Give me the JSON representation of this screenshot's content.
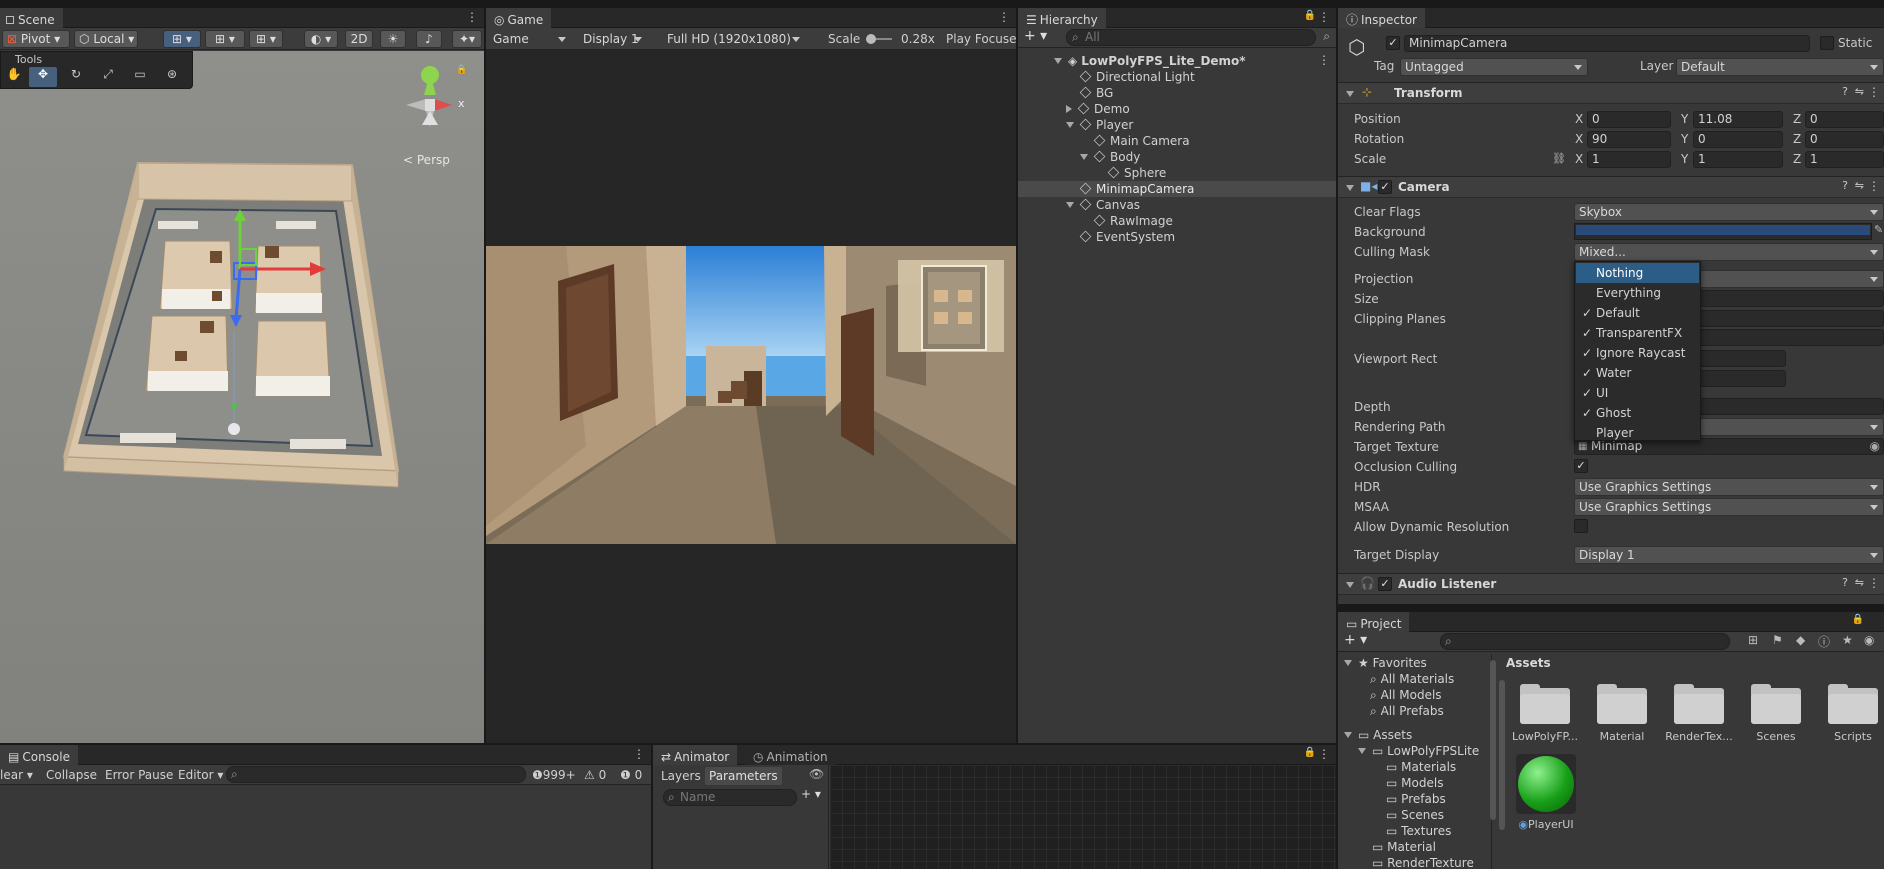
{
  "scene": {
    "tab": "Scene",
    "pivot": "Pivot",
    "local": "Local",
    "mode2d": "2D",
    "tools_label": "Tools",
    "persp": "Persp",
    "gizmo_x": "x"
  },
  "game": {
    "tab": "Game",
    "view": "Game",
    "display": "Display 1",
    "resolution": "Full HD (1920x1080)",
    "scale_label": "Scale",
    "scale_value": "0.28x",
    "play_focused": "Play Focuse"
  },
  "hierarchy": {
    "tab": "Hierarchy",
    "search_placeholder": "All",
    "items": [
      {
        "label": "LowPolyFPS_Lite_Demo*"
      },
      {
        "label": "Directional Light"
      },
      {
        "label": "BG"
      },
      {
        "label": "Demo"
      },
      {
        "label": "Player"
      },
      {
        "label": "Main Camera"
      },
      {
        "label": "Body"
      },
      {
        "label": "Sphere"
      },
      {
        "label": "MinimapCamera"
      },
      {
        "label": "Canvas"
      },
      {
        "label": "RawImage"
      },
      {
        "label": "EventSystem"
      }
    ]
  },
  "inspector": {
    "tab": "Inspector",
    "object_name": "MinimapCamera",
    "static_label": "Static",
    "tag_label": "Tag",
    "tag_value": "Untagged",
    "layer_label": "Layer",
    "layer_value": "Default",
    "transform": {
      "title": "Transform",
      "position_label": "Position",
      "rotation_label": "Rotation",
      "scale_label": "Scale",
      "x": "X",
      "y": "Y",
      "z": "Z",
      "position": {
        "x": "0",
        "y": "11.08",
        "z": "0"
      },
      "rotation": {
        "x": "90",
        "y": "0",
        "z": "0"
      },
      "scale": {
        "x": "1",
        "y": "1",
        "z": "1"
      }
    },
    "camera": {
      "title": "Camera",
      "clear_flags_label": "Clear Flags",
      "clear_flags_value": "Skybox",
      "background_label": "Background",
      "background_color": "#2a4a7a",
      "culling_mask_label": "Culling Mask",
      "culling_mask_value": "Mixed...",
      "projection_label": "Projection",
      "size_label": "Size",
      "clipping_label": "Clipping Planes",
      "viewport_label": "Viewport Rect",
      "viewport_x_partial": "0",
      "viewport_w_partial": "l",
      "depth_label": "Depth",
      "rendering_path_label": "Rendering Path",
      "target_texture_label": "Target Texture",
      "target_texture_value": "Minimap",
      "occlusion_label": "Occlusion Culling",
      "hdr_label": "HDR",
      "hdr_value": "Use Graphics Settings",
      "msaa_label": "MSAA",
      "msaa_value": "Use Graphics Settings",
      "dynamic_res_label": "Allow Dynamic Resolution",
      "target_display_label": "Target Display",
      "target_display_value": "Display 1"
    },
    "audio_listener": {
      "title": "Audio Listener"
    },
    "culling_menu": [
      {
        "label": "Nothing",
        "checked": false,
        "highlighted": true
      },
      {
        "label": "Everything",
        "checked": false
      },
      {
        "label": "Default",
        "checked": true
      },
      {
        "label": "TransparentFX",
        "checked": true
      },
      {
        "label": "Ignore Raycast",
        "checked": true
      },
      {
        "label": "Water",
        "checked": true
      },
      {
        "label": "UI",
        "checked": true
      },
      {
        "label": "Ghost",
        "checked": true
      },
      {
        "label": "Player",
        "checked": false
      }
    ]
  },
  "project": {
    "tab": "Project",
    "favorites": "Favorites",
    "fav_items": [
      "All Materials",
      "All Models",
      "All Prefabs"
    ],
    "assets_root": "Assets",
    "tree": [
      "LowPolyFPSLite",
      "Materials",
      "Models",
      "Prefabs",
      "Scenes",
      "Textures",
      "Material",
      "RenderTexture"
    ],
    "breadcrumb": "Assets",
    "assets": [
      "LowPolyFP...",
      "Material",
      "RenderTex...",
      "Scenes",
      "Scripts",
      "PlayerUI"
    ]
  },
  "console": {
    "tab": "Console",
    "clear": "lear",
    "collapse": "Collapse",
    "error_pause": "Error Pause",
    "editor": "Editor",
    "count_log": "999+",
    "count_warn": "0",
    "count_err": "0"
  },
  "animator": {
    "tab": "Animator",
    "tab2": "Animation",
    "layers": "Layers",
    "parameters": "Parameters",
    "name_placeholder": "Name"
  }
}
